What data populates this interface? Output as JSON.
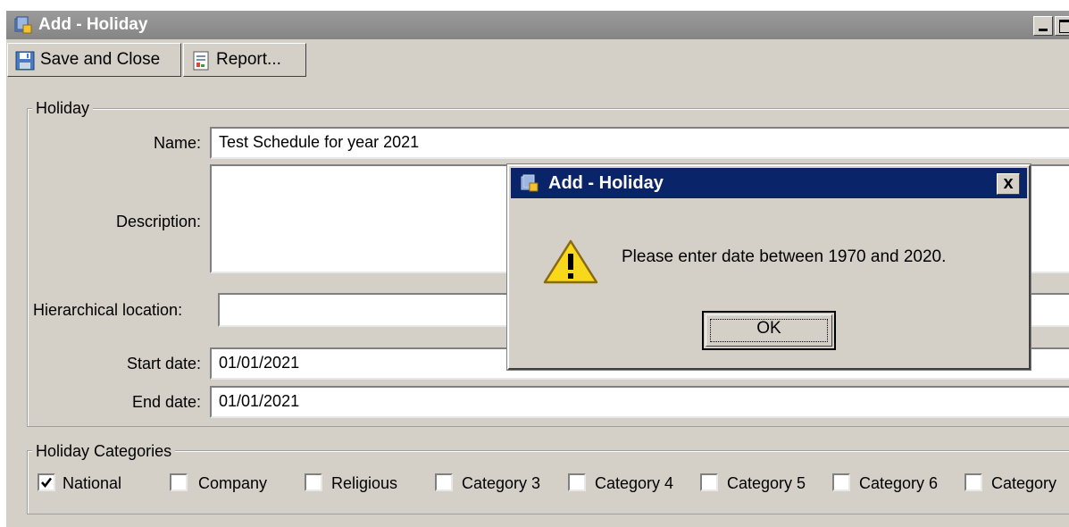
{
  "window": {
    "title": "Add - Holiday"
  },
  "toolbar": {
    "save_close_label": "Save and Close",
    "report_label": "Report..."
  },
  "holiday_group": {
    "title": "Holiday",
    "name_label": "Name:",
    "name_value": "Test Schedule for year 2021",
    "description_label": "Description:",
    "description_value": "",
    "hierarchical_location_label": "Hierarchical location:",
    "hierarchical_location_value": "",
    "start_date_label": "Start date:",
    "start_date_value": "01/01/2021",
    "end_date_label": "End date:",
    "end_date_value": "01/01/2021"
  },
  "categories_group": {
    "title": "Holiday Categories",
    "items": [
      {
        "label": "National",
        "checked": true
      },
      {
        "label": "Company",
        "checked": false
      },
      {
        "label": "Religious",
        "checked": false
      },
      {
        "label": "Category 3",
        "checked": false
      },
      {
        "label": "Category 4",
        "checked": false
      },
      {
        "label": "Category 5",
        "checked": false
      },
      {
        "label": "Category 6",
        "checked": false
      },
      {
        "label": "Category",
        "checked": false
      }
    ]
  },
  "dialog": {
    "title": "Add - Holiday",
    "close_glyph": "x",
    "message": "Please enter date between 1970 and 2020.",
    "ok_label": "OK"
  },
  "colors": {
    "dialog_titlebar": "#0a246a",
    "window_titlebar": "#8e8e8e",
    "face": "#d4d0c8"
  }
}
